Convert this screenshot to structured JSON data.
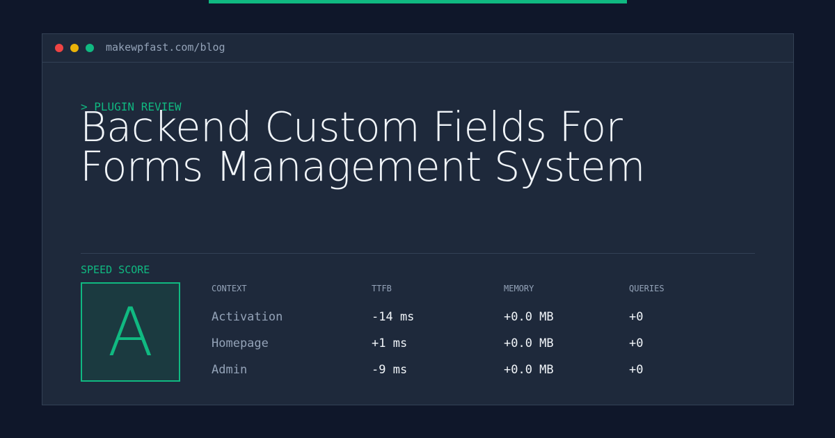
{
  "colors": {
    "background": "#0f172a",
    "panel": "#1e293b",
    "accent": "#10b981",
    "muted": "#94a3b8",
    "text": "#f1f5f9"
  },
  "window": {
    "controls": [
      "close-dot",
      "minimize-dot",
      "maximize-dot"
    ],
    "url": "makewpfast.com/blog"
  },
  "article": {
    "eyebrow": "> PLUGIN REVIEW",
    "title": "Backend Custom Fields For Forms Management System"
  },
  "speed": {
    "label": "SPEED SCORE",
    "grade": "A"
  },
  "metrics": {
    "headers": [
      "CONTEXT",
      "TTFB",
      "MEMORY",
      "QUERIES"
    ],
    "rows": [
      {
        "context": "Activation",
        "ttfb": "-14 ms",
        "memory": "+0.0 MB",
        "queries": "+0"
      },
      {
        "context": "Homepage",
        "ttfb": "+1 ms",
        "memory": "+0.0 MB",
        "queries": "+0"
      },
      {
        "context": "Admin",
        "ttfb": "-9 ms",
        "memory": "+0.0 MB",
        "queries": "+0"
      }
    ]
  }
}
